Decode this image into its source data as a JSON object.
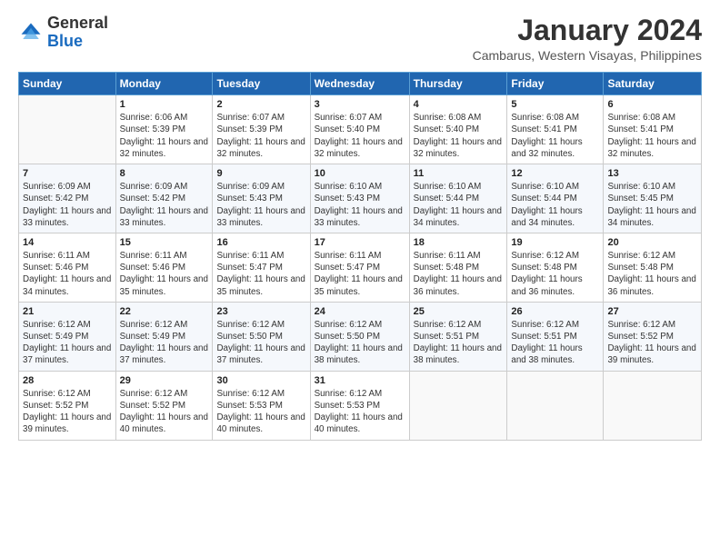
{
  "logo": {
    "general": "General",
    "blue": "Blue"
  },
  "header": {
    "title": "January 2024",
    "subtitle": "Cambarus, Western Visayas, Philippines"
  },
  "weekdays": [
    "Sunday",
    "Monday",
    "Tuesday",
    "Wednesday",
    "Thursday",
    "Friday",
    "Saturday"
  ],
  "weeks": [
    [
      {
        "day": "",
        "sunrise": "",
        "sunset": "",
        "daylight": ""
      },
      {
        "day": "1",
        "sunrise": "Sunrise: 6:06 AM",
        "sunset": "Sunset: 5:39 PM",
        "daylight": "Daylight: 11 hours and 32 minutes."
      },
      {
        "day": "2",
        "sunrise": "Sunrise: 6:07 AM",
        "sunset": "Sunset: 5:39 PM",
        "daylight": "Daylight: 11 hours and 32 minutes."
      },
      {
        "day": "3",
        "sunrise": "Sunrise: 6:07 AM",
        "sunset": "Sunset: 5:40 PM",
        "daylight": "Daylight: 11 hours and 32 minutes."
      },
      {
        "day": "4",
        "sunrise": "Sunrise: 6:08 AM",
        "sunset": "Sunset: 5:40 PM",
        "daylight": "Daylight: 11 hours and 32 minutes."
      },
      {
        "day": "5",
        "sunrise": "Sunrise: 6:08 AM",
        "sunset": "Sunset: 5:41 PM",
        "daylight": "Daylight: 11 hours and 32 minutes."
      },
      {
        "day": "6",
        "sunrise": "Sunrise: 6:08 AM",
        "sunset": "Sunset: 5:41 PM",
        "daylight": "Daylight: 11 hours and 32 minutes."
      }
    ],
    [
      {
        "day": "7",
        "sunrise": "Sunrise: 6:09 AM",
        "sunset": "Sunset: 5:42 PM",
        "daylight": "Daylight: 11 hours and 33 minutes."
      },
      {
        "day": "8",
        "sunrise": "Sunrise: 6:09 AM",
        "sunset": "Sunset: 5:42 PM",
        "daylight": "Daylight: 11 hours and 33 minutes."
      },
      {
        "day": "9",
        "sunrise": "Sunrise: 6:09 AM",
        "sunset": "Sunset: 5:43 PM",
        "daylight": "Daylight: 11 hours and 33 minutes."
      },
      {
        "day": "10",
        "sunrise": "Sunrise: 6:10 AM",
        "sunset": "Sunset: 5:43 PM",
        "daylight": "Daylight: 11 hours and 33 minutes."
      },
      {
        "day": "11",
        "sunrise": "Sunrise: 6:10 AM",
        "sunset": "Sunset: 5:44 PM",
        "daylight": "Daylight: 11 hours and 34 minutes."
      },
      {
        "day": "12",
        "sunrise": "Sunrise: 6:10 AM",
        "sunset": "Sunset: 5:44 PM",
        "daylight": "Daylight: 11 hours and 34 minutes."
      },
      {
        "day": "13",
        "sunrise": "Sunrise: 6:10 AM",
        "sunset": "Sunset: 5:45 PM",
        "daylight": "Daylight: 11 hours and 34 minutes."
      }
    ],
    [
      {
        "day": "14",
        "sunrise": "Sunrise: 6:11 AM",
        "sunset": "Sunset: 5:46 PM",
        "daylight": "Daylight: 11 hours and 34 minutes."
      },
      {
        "day": "15",
        "sunrise": "Sunrise: 6:11 AM",
        "sunset": "Sunset: 5:46 PM",
        "daylight": "Daylight: 11 hours and 35 minutes."
      },
      {
        "day": "16",
        "sunrise": "Sunrise: 6:11 AM",
        "sunset": "Sunset: 5:47 PM",
        "daylight": "Daylight: 11 hours and 35 minutes."
      },
      {
        "day": "17",
        "sunrise": "Sunrise: 6:11 AM",
        "sunset": "Sunset: 5:47 PM",
        "daylight": "Daylight: 11 hours and 35 minutes."
      },
      {
        "day": "18",
        "sunrise": "Sunrise: 6:11 AM",
        "sunset": "Sunset: 5:48 PM",
        "daylight": "Daylight: 11 hours and 36 minutes."
      },
      {
        "day": "19",
        "sunrise": "Sunrise: 6:12 AM",
        "sunset": "Sunset: 5:48 PM",
        "daylight": "Daylight: 11 hours and 36 minutes."
      },
      {
        "day": "20",
        "sunrise": "Sunrise: 6:12 AM",
        "sunset": "Sunset: 5:48 PM",
        "daylight": "Daylight: 11 hours and 36 minutes."
      }
    ],
    [
      {
        "day": "21",
        "sunrise": "Sunrise: 6:12 AM",
        "sunset": "Sunset: 5:49 PM",
        "daylight": "Daylight: 11 hours and 37 minutes."
      },
      {
        "day": "22",
        "sunrise": "Sunrise: 6:12 AM",
        "sunset": "Sunset: 5:49 PM",
        "daylight": "Daylight: 11 hours and 37 minutes."
      },
      {
        "day": "23",
        "sunrise": "Sunrise: 6:12 AM",
        "sunset": "Sunset: 5:50 PM",
        "daylight": "Daylight: 11 hours and 37 minutes."
      },
      {
        "day": "24",
        "sunrise": "Sunrise: 6:12 AM",
        "sunset": "Sunset: 5:50 PM",
        "daylight": "Daylight: 11 hours and 38 minutes."
      },
      {
        "day": "25",
        "sunrise": "Sunrise: 6:12 AM",
        "sunset": "Sunset: 5:51 PM",
        "daylight": "Daylight: 11 hours and 38 minutes."
      },
      {
        "day": "26",
        "sunrise": "Sunrise: 6:12 AM",
        "sunset": "Sunset: 5:51 PM",
        "daylight": "Daylight: 11 hours and 38 minutes."
      },
      {
        "day": "27",
        "sunrise": "Sunrise: 6:12 AM",
        "sunset": "Sunset: 5:52 PM",
        "daylight": "Daylight: 11 hours and 39 minutes."
      }
    ],
    [
      {
        "day": "28",
        "sunrise": "Sunrise: 6:12 AM",
        "sunset": "Sunset: 5:52 PM",
        "daylight": "Daylight: 11 hours and 39 minutes."
      },
      {
        "day": "29",
        "sunrise": "Sunrise: 6:12 AM",
        "sunset": "Sunset: 5:52 PM",
        "daylight": "Daylight: 11 hours and 40 minutes."
      },
      {
        "day": "30",
        "sunrise": "Sunrise: 6:12 AM",
        "sunset": "Sunset: 5:53 PM",
        "daylight": "Daylight: 11 hours and 40 minutes."
      },
      {
        "day": "31",
        "sunrise": "Sunrise: 6:12 AM",
        "sunset": "Sunset: 5:53 PM",
        "daylight": "Daylight: 11 hours and 40 minutes."
      },
      {
        "day": "",
        "sunrise": "",
        "sunset": "",
        "daylight": ""
      },
      {
        "day": "",
        "sunrise": "",
        "sunset": "",
        "daylight": ""
      },
      {
        "day": "",
        "sunrise": "",
        "sunset": "",
        "daylight": ""
      }
    ]
  ]
}
